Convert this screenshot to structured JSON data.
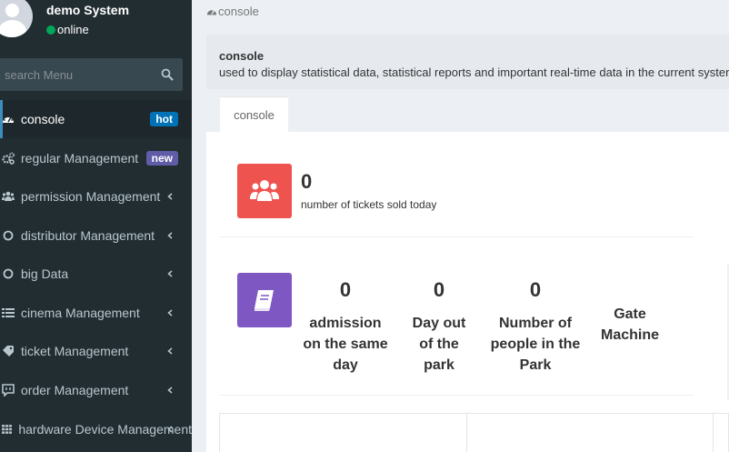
{
  "user": {
    "name": "demo System",
    "status": "online",
    "status_color": "#00a65a"
  },
  "search": {
    "placeholder": "search Menu"
  },
  "menu": [
    {
      "label": "console",
      "icon": "dashboard-icon",
      "badge": "hot",
      "active": true
    },
    {
      "label": "regular Management",
      "icon": "cogs-icon",
      "badge": "new"
    },
    {
      "label": "permission Management",
      "icon": "users-icon"
    },
    {
      "label": "distributor Management",
      "icon": "circle-icon"
    },
    {
      "label": "big Data",
      "icon": "circle-icon"
    },
    {
      "label": "cinema Management",
      "icon": "list-icon"
    },
    {
      "label": "ticket Management",
      "icon": "tag-icon"
    },
    {
      "label": "order Management",
      "icon": "chat-icon"
    },
    {
      "label": "hardware Device Management",
      "icon": "grid-icon"
    }
  ],
  "breadcrumb": {
    "label": "console"
  },
  "header": {
    "title": "console",
    "description": "used to display statistical data, statistical reports and important real-time data in the current system"
  },
  "tabs": [
    {
      "label": "console"
    }
  ],
  "stats": {
    "tickets": {
      "value": "0",
      "label": "number of tickets sold today",
      "color": "#ef5350",
      "icon": "users-icon"
    },
    "park": {
      "color": "#7e57c2",
      "icon": "book-icon",
      "items": [
        {
          "value": "0",
          "label_lines": [
            "admission",
            "on the same",
            "day"
          ]
        },
        {
          "value": "0",
          "label_lines": [
            "Day out",
            "of the",
            "park"
          ]
        },
        {
          "value": "0",
          "label_lines": [
            "Number of",
            "people in the",
            "Park"
          ]
        },
        {
          "value": "",
          "label_lines": [
            "Gate",
            "Machine"
          ]
        }
      ]
    }
  }
}
